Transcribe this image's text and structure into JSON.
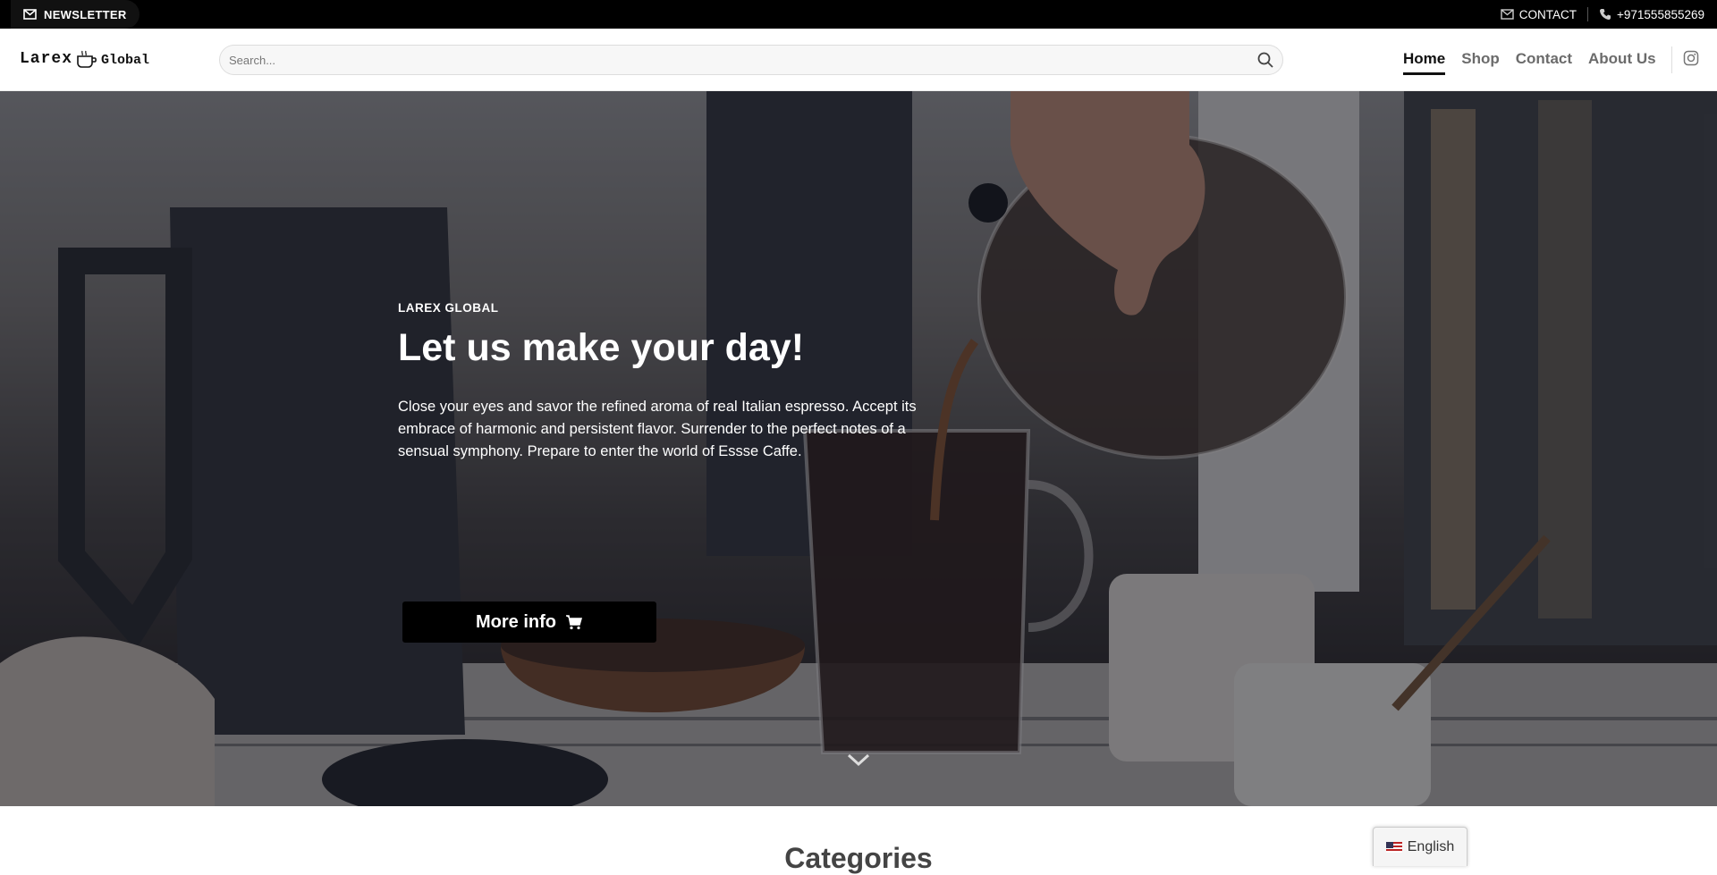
{
  "topbar": {
    "newsletter_label": "NEWSLETTER",
    "contact_label": "CONTACT",
    "phone": "+971555855269"
  },
  "header": {
    "logo_part1": "Larex",
    "logo_part2": "Global",
    "search_placeholder": "Search...",
    "nav": [
      {
        "label": "Home",
        "active": true
      },
      {
        "label": "Shop",
        "active": false
      },
      {
        "label": "Contact",
        "active": false
      },
      {
        "label": "About Us",
        "active": false
      }
    ]
  },
  "hero": {
    "kicker": "LAREX GLOBAL",
    "headline": "Let us make your day!",
    "description": "Close your eyes and savor the refined aroma of real Italian espresso. Accept its embrace of harmonic and persistent flavor. Surrender to the perfect notes of a sensual symphony. Prepare to enter the world of Essse Caffe.",
    "button_label": "More info"
  },
  "sections": {
    "categories_title": "Categories"
  },
  "language": {
    "label": "English"
  },
  "colors": {
    "topbar_bg": "#000000",
    "button_bg": "#000000",
    "nav_active": "#111111",
    "nav_inactive": "#6b6b6b"
  }
}
